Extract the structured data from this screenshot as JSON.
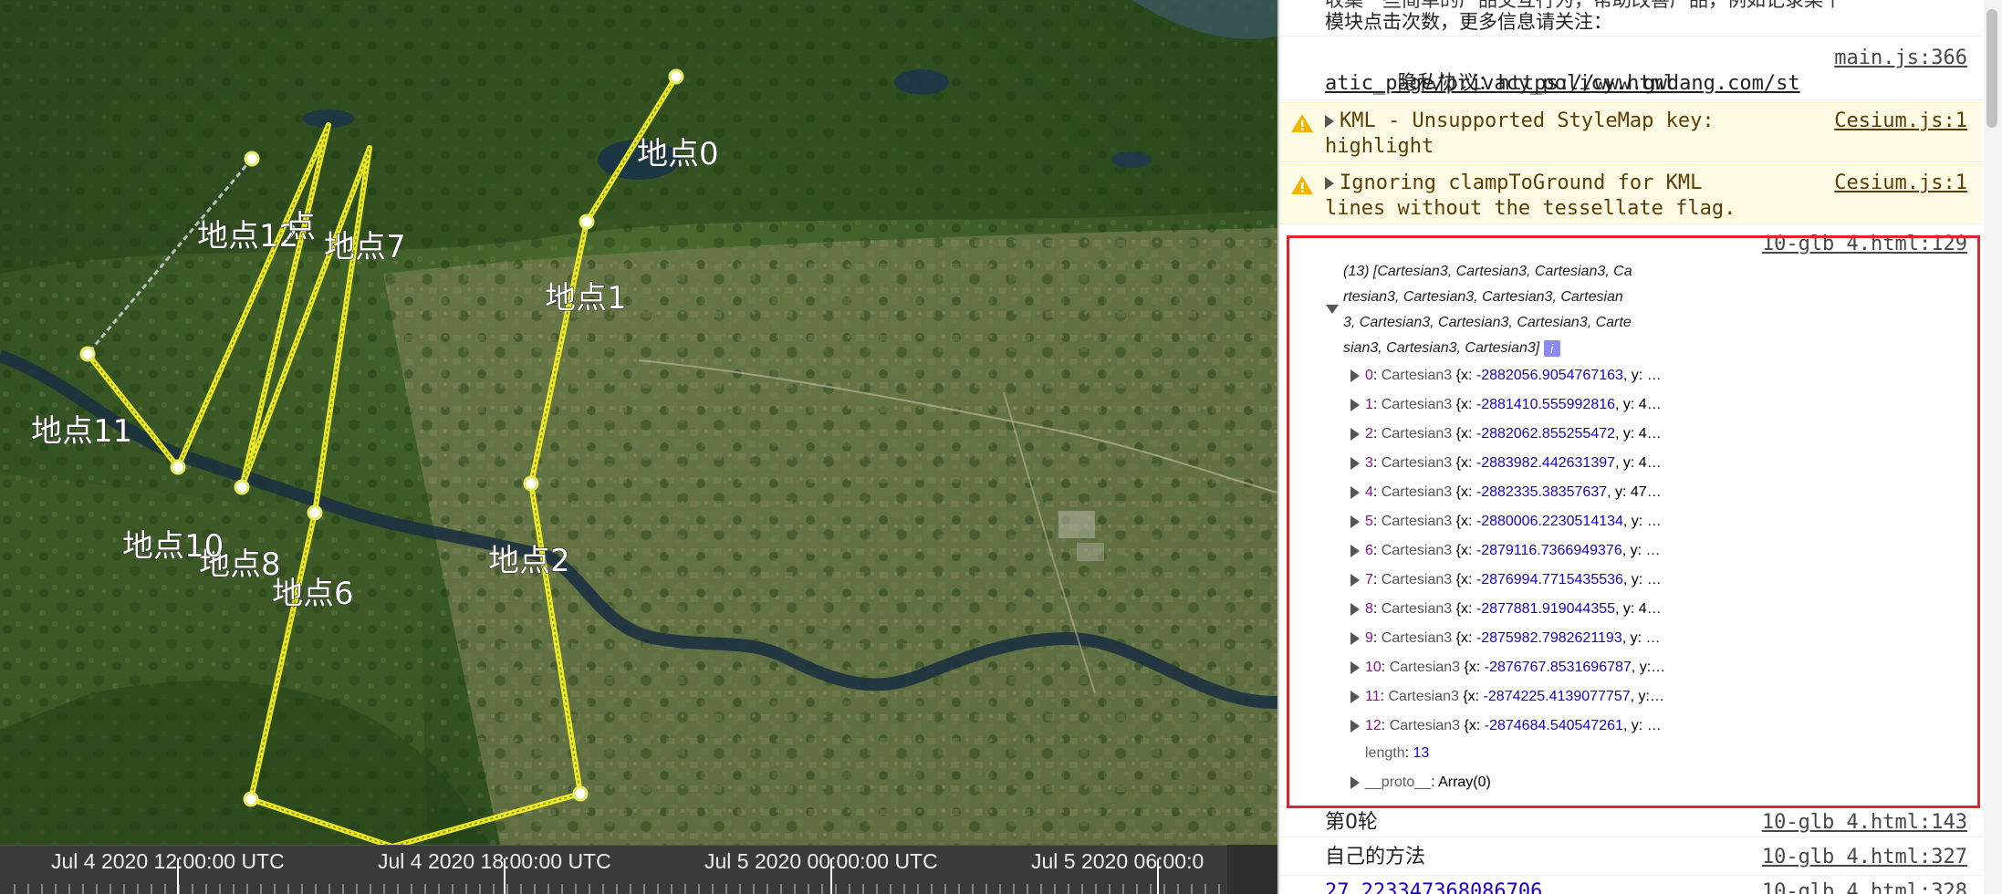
{
  "map": {
    "labels": [
      {
        "text": "地点0"
      },
      {
        "text": "地点1"
      },
      {
        "text": "地点2"
      },
      {
        "text": "地点6"
      },
      {
        "text": "地点7"
      },
      {
        "text": "地点8"
      },
      {
        "text": "地点10"
      },
      {
        "text": "地点11"
      },
      {
        "text": "地点12"
      },
      {
        "text": "点"
      }
    ]
  },
  "timeline": {
    "labels": [
      "Jul 4 2020 12:00:00 UTC",
      "Jul 4 2020 18:00:00 UTC",
      "Jul 5 2020 00:00:00 UTC",
      "Jul 5 2020 06:00:0"
    ]
  },
  "console": {
    "top_text": "模块点击次数，更多信息请关注：",
    "privacy": {
      "label": "隐私协议：",
      "url_1": "https://www.gwdang.com/st",
      "url_2": "atic_page/privacy_policy.html",
      "source": "main.js:366"
    },
    "warn1": {
      "line1": "KML - Unsupported StyleMap key:",
      "line2": "highlight",
      "source": "Cesium.js:1"
    },
    "warn2": {
      "line1": "Ignoring clampToGround for KML",
      "line2": "lines without the tessellate flag.",
      "source": "Cesium.js:1"
    },
    "array_log": {
      "source": "10-glb 4.html:129",
      "header_lines": [
        "(13) [Cartesian3, Cartesian3, Cartesian3, Ca",
        "rtesian3, Cartesian3, Cartesian3, Cartesian",
        "3, Cartesian3, Cartesian3, Cartesian3, Carte",
        "sian3, Cartesian3, Cartesian3]"
      ],
      "items": [
        {
          "key": "0",
          "cls": "Cartesian3",
          "x": "-2882056.9054767163",
          "tail": ", y: …"
        },
        {
          "key": "1",
          "cls": "Cartesian3",
          "x": "-2881410.555992816",
          "tail": ", y: 4…"
        },
        {
          "key": "2",
          "cls": "Cartesian3",
          "x": "-2882062.855255472",
          "tail": ", y: 4…"
        },
        {
          "key": "3",
          "cls": "Cartesian3",
          "x": "-2883982.442631397",
          "tail": ", y: 4…"
        },
        {
          "key": "4",
          "cls": "Cartesian3",
          "x": "-2882335.38357637",
          "tail": ", y: 47…"
        },
        {
          "key": "5",
          "cls": "Cartesian3",
          "x": "-2880006.2230514134",
          "tail": ", y: …"
        },
        {
          "key": "6",
          "cls": "Cartesian3",
          "x": "-2879116.7366949376",
          "tail": ", y: …"
        },
        {
          "key": "7",
          "cls": "Cartesian3",
          "x": "-2876994.7715435536",
          "tail": ", y: …"
        },
        {
          "key": "8",
          "cls": "Cartesian3",
          "x": "-2877881.919044355",
          "tail": ", y: 4…"
        },
        {
          "key": "9",
          "cls": "Cartesian3",
          "x": "-2875982.7982621193",
          "tail": ", y: …"
        },
        {
          "key": "10",
          "cls": "Cartesian3",
          "x": "-2876767.8531696787",
          "tail": ", y:…"
        },
        {
          "key": "11",
          "cls": "Cartesian3",
          "x": "-2874225.4139077757",
          "tail": ", y:…"
        },
        {
          "key": "12",
          "cls": "Cartesian3",
          "x": "-2874684.540547261",
          "tail": ", y: …"
        }
      ],
      "length_key": "length",
      "length_val": "13",
      "proto_key": "__proto__",
      "proto_val": ": Array(0)"
    },
    "log_round": {
      "text": "第0轮",
      "source": "10-glb 4.html:143"
    },
    "log_method": {
      "text": "自己的方法",
      "source": "10-glb 4.html:327"
    },
    "log_number": {
      "text": "27.223347368086706",
      "source": "10-glb 4.html:328"
    }
  }
}
